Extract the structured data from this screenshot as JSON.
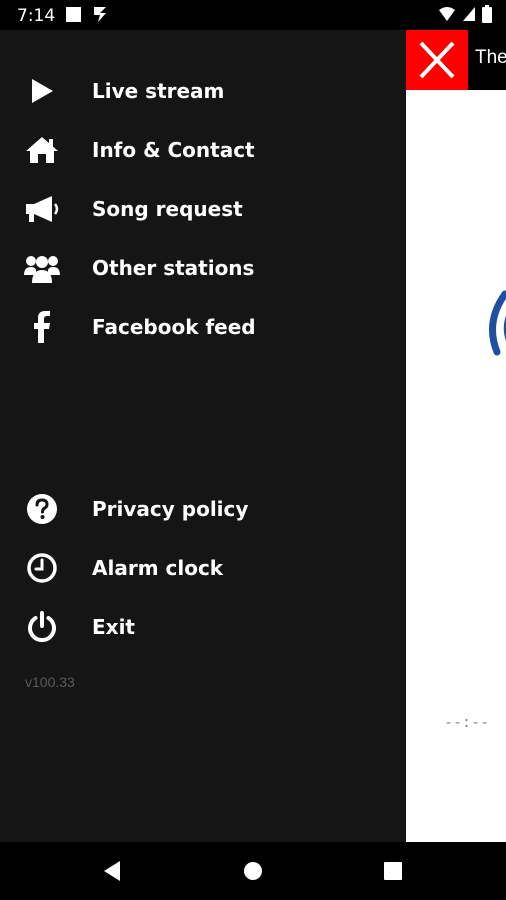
{
  "status_bar": {
    "time": "7:14"
  },
  "banner": {
    "text": "The"
  },
  "menu": {
    "items": [
      {
        "label": "Live stream",
        "icon": "play-icon"
      },
      {
        "label": "Info & Contact",
        "icon": "home-icon"
      },
      {
        "label": "Song request",
        "icon": "megaphone-icon"
      },
      {
        "label": "Other stations",
        "icon": "group-icon"
      },
      {
        "label": "Facebook feed",
        "icon": "facebook-icon"
      }
    ],
    "secondary": [
      {
        "label": "Privacy policy",
        "icon": "question-icon"
      },
      {
        "label": "Alarm clock",
        "icon": "clock-icon"
      },
      {
        "label": "Exit",
        "icon": "power-icon"
      }
    ],
    "version": "v100.33"
  },
  "player": {
    "time_display": "--:--"
  },
  "colors": {
    "drawer_bg": "#151515",
    "close_bg": "#ff0000",
    "logo_blue": "#1f4fa3"
  }
}
